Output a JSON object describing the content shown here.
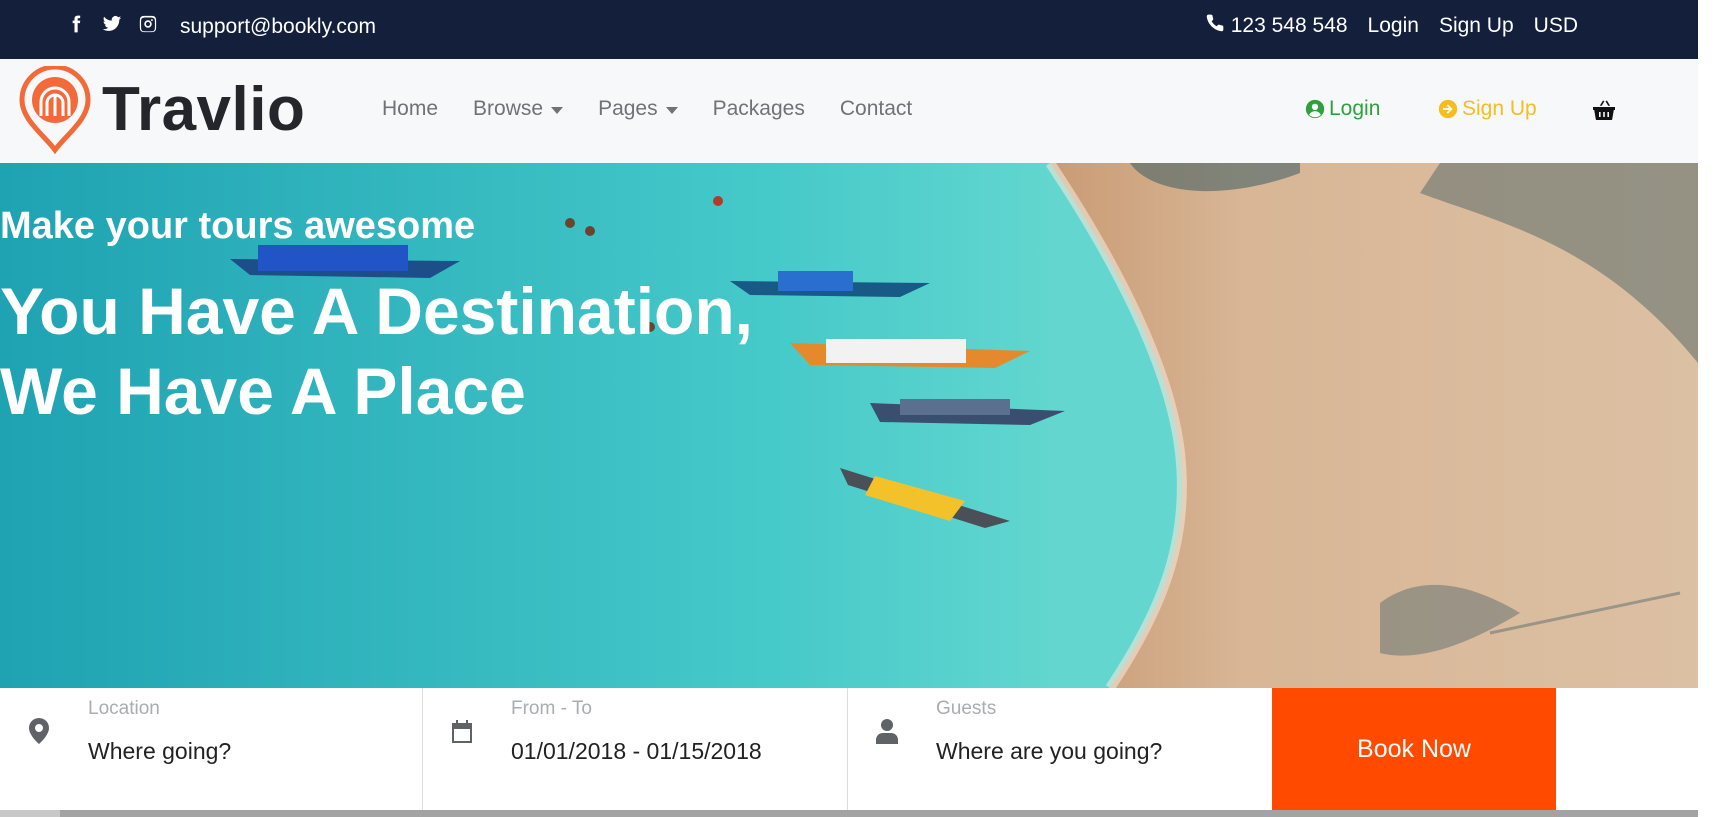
{
  "topbar": {
    "social_icons": [
      "facebook-icon",
      "twitter-icon",
      "instagram-icon"
    ],
    "email": "support@bookly.com",
    "phone": "123 548 548",
    "login": "Login",
    "signup": "Sign Up",
    "currency": "USD"
  },
  "nav": {
    "brand": "Travlio",
    "links": [
      {
        "label": "Home",
        "dropdown": false
      },
      {
        "label": "Browse",
        "dropdown": true
      },
      {
        "label": "Pages",
        "dropdown": true
      },
      {
        "label": "Packages",
        "dropdown": false
      },
      {
        "label": "Contact",
        "dropdown": false
      }
    ],
    "login": "Login",
    "signup": "Sign Up",
    "cart_icon": "basket-icon"
  },
  "hero": {
    "subtitle": "Make your tours awesome",
    "title_line1": "You Have A Destination,",
    "title_line2": "We Have A Place"
  },
  "booking": {
    "location_label": "Location",
    "location_value": "Where going?",
    "dates_label": "From - To",
    "dates_value": "01/01/2018 - 01/15/2018",
    "guests_label": "Guests",
    "guests_value": "Where are you going?",
    "book_button": "Book Now"
  },
  "colors": {
    "topbar_bg": "#141f3c",
    "login_green": "#2fa13c",
    "signup_yellow": "#f5bd1f",
    "book_orange": "#ff4a00",
    "logo_orange": "#f26a3a"
  }
}
